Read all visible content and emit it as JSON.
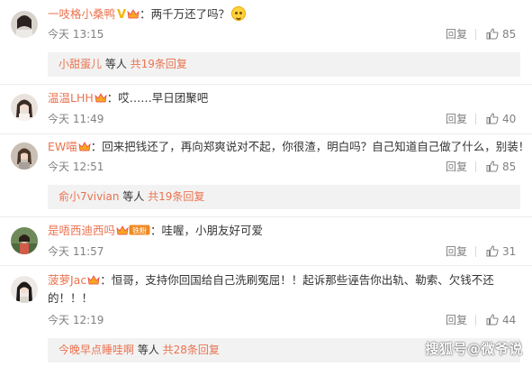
{
  "comments": [
    {
      "username": "一吱格小桑鸭",
      "text": "两千万还了吗？",
      "time": "今天 13:15",
      "reply_label": "回复",
      "likes": "85",
      "subreplies": {
        "user": "小甜蛋儿",
        "middle": " 等人 ",
        "more": "共19条回复"
      }
    },
    {
      "username": "温温LHH",
      "text": "哎……早日团聚吧",
      "time": "今天 11:49",
      "reply_label": "回复",
      "likes": "40"
    },
    {
      "username": "EW喵",
      "text": "回来把钱还了，再向郑爽说对不起，你很渣，明白吗？自己知道自己做了什么，别装！",
      "time": "今天 12:51",
      "reply_label": "回复",
      "likes": "85",
      "subreplies": {
        "user": "俞小7vivian",
        "middle": " 等人 ",
        "more": "共19条回复"
      }
    },
    {
      "username": "是唔西迪西吗",
      "fan_badge": "铁粉",
      "text": "哇喔，小朋友好可爱",
      "time": "今天 11:57",
      "reply_label": "回复",
      "likes": "31"
    },
    {
      "username": "菠萝Jac",
      "text_line1": "恒哥，支持你回国给自己洗刷冤屈！！起诉那些诬告你出轨、勒索、欠钱不还",
      "text_line2": "的！！！",
      "time": "今天 12:19",
      "reply_label": "回复",
      "likes": "44",
      "subreplies": {
        "user": "今晚早点睡哇啊",
        "middle": " 等人 ",
        "more": "共28条回复"
      }
    }
  ],
  "separator": "：",
  "watermark": "搜狐号@微爷说",
  "colors": {
    "username": "#eb7350",
    "meta": "#808080",
    "subreply_bg": "#f2f2f2"
  }
}
